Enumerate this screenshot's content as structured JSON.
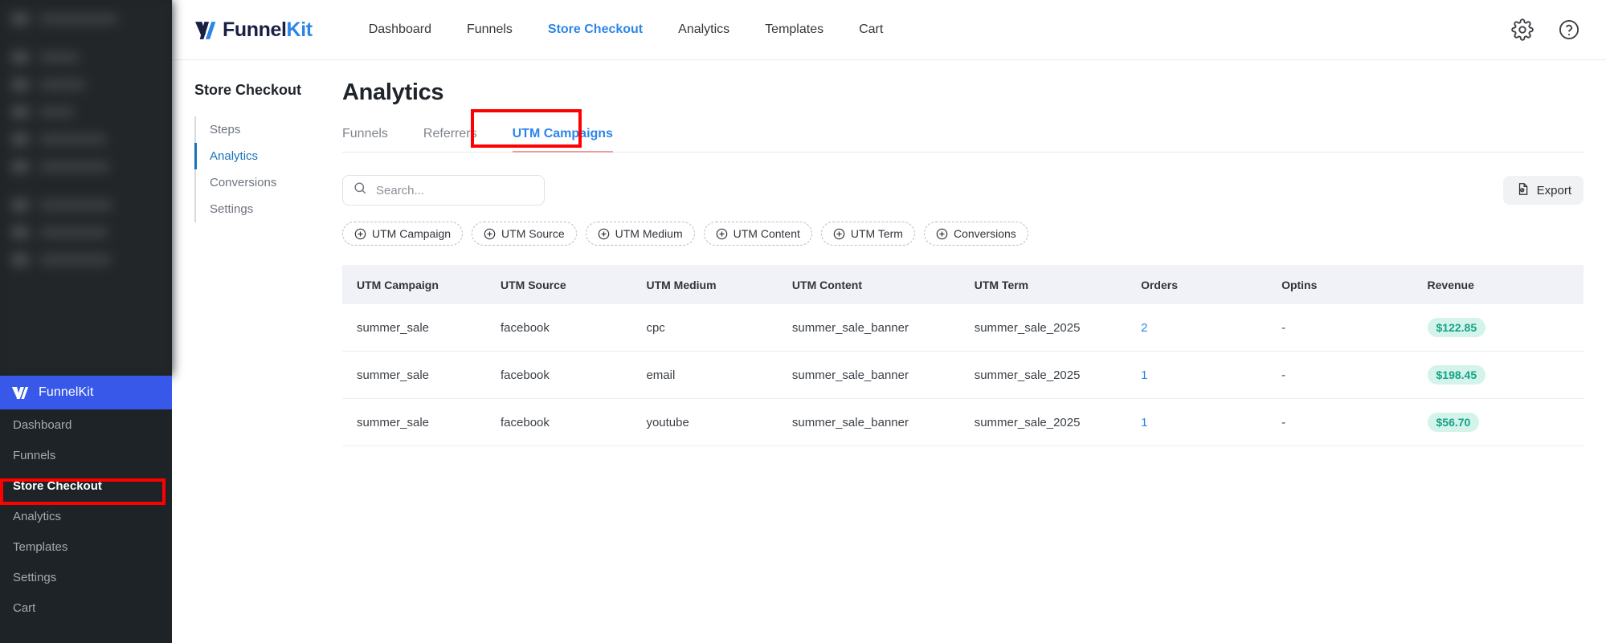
{
  "wp_sidebar": {
    "blurred_items_count": 9,
    "brand": {
      "name": "FunnelKit",
      "bg_color": "#3858e9"
    },
    "menu": [
      {
        "label": "Dashboard",
        "active": false
      },
      {
        "label": "Funnels",
        "active": false
      },
      {
        "label": "Store Checkout",
        "active": true,
        "highlighted": true
      },
      {
        "label": "Analytics",
        "active": false
      },
      {
        "label": "Templates",
        "active": false
      },
      {
        "label": "Settings",
        "active": false
      },
      {
        "label": "Cart",
        "active": false
      }
    ]
  },
  "topbar": {
    "logo": {
      "part1": "Funnel",
      "part2": "Kit"
    },
    "nav": [
      {
        "label": "Dashboard",
        "active": false
      },
      {
        "label": "Funnels",
        "active": false
      },
      {
        "label": "Store Checkout",
        "active": true
      },
      {
        "label": "Analytics",
        "active": false
      },
      {
        "label": "Templates",
        "active": false
      },
      {
        "label": "Cart",
        "active": false
      }
    ],
    "settings_icon": "gear-icon",
    "help_icon": "help-circle-icon"
  },
  "sub_sidebar": {
    "title": "Store Checkout",
    "items": [
      {
        "label": "Steps",
        "active": false
      },
      {
        "label": "Analytics",
        "active": true
      },
      {
        "label": "Conversions",
        "active": false
      },
      {
        "label": "Settings",
        "active": false
      }
    ]
  },
  "page": {
    "title": "Analytics",
    "tabs": [
      {
        "label": "Funnels",
        "active": false
      },
      {
        "label": "Referrers",
        "active": false
      },
      {
        "label": "UTM Campaigns",
        "active": true,
        "highlighted": true
      }
    ],
    "search": {
      "value": "",
      "placeholder": "Search..."
    },
    "export_button": {
      "label": "Export",
      "icon": "export-file-icon"
    },
    "filter_chips": [
      {
        "label": "UTM Campaign"
      },
      {
        "label": "UTM Source"
      },
      {
        "label": "UTM Medium"
      },
      {
        "label": "UTM Content"
      },
      {
        "label": "UTM Term"
      },
      {
        "label": "Conversions"
      }
    ],
    "table": {
      "columns": [
        "UTM Campaign",
        "UTM Source",
        "UTM Medium",
        "UTM Content",
        "UTM Term",
        "Orders",
        "Optins",
        "Revenue"
      ],
      "rows": [
        {
          "utm_campaign": "summer_sale",
          "utm_source": "facebook",
          "utm_medium": "cpc",
          "utm_content": "summer_sale_banner",
          "utm_term": "summer_sale_2025",
          "orders": "2",
          "optins": "-",
          "revenue": "$122.85"
        },
        {
          "utm_campaign": "summer_sale",
          "utm_source": "facebook",
          "utm_medium": "email",
          "utm_content": "summer_sale_banner",
          "utm_term": "summer_sale_2025",
          "orders": "1",
          "optins": "-",
          "revenue": "$198.45"
        },
        {
          "utm_campaign": "summer_sale",
          "utm_source": "facebook",
          "utm_medium": "youtube",
          "utm_content": "summer_sale_banner",
          "utm_term": "summer_sale_2025",
          "orders": "1",
          "optins": "-",
          "revenue": "$56.70"
        }
      ]
    }
  },
  "colors": {
    "accent_blue": "#2d85e8",
    "wp_brand_blue": "#3858e9",
    "revenue_badge_bg": "#d4f3ea",
    "revenue_badge_text": "#13a387",
    "annotation_red": "#ff0000",
    "table_header_bg": "#f1f2f7"
  }
}
